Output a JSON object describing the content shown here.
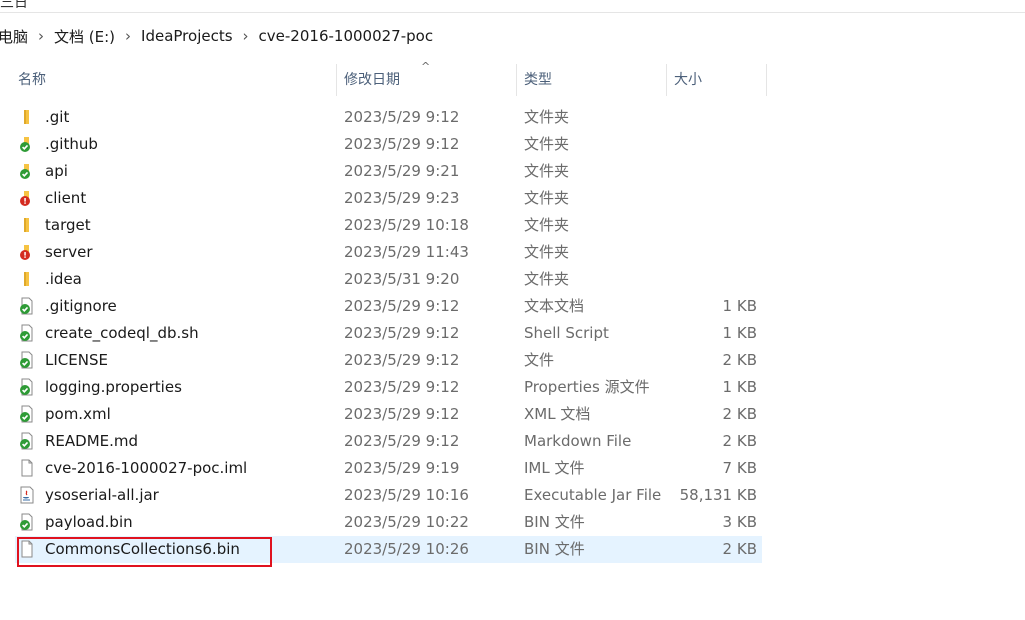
{
  "topstrip": {
    "cut_text": "三日"
  },
  "breadcrumb": {
    "items": [
      "电脑",
      "文档 (E:)",
      "IdeaProjects",
      "cve-2016-1000027-poc"
    ],
    "separator": "›"
  },
  "columns": {
    "name": "名称",
    "date": "修改日期",
    "type": "类型",
    "size": "大小",
    "sort_indicator": "^"
  },
  "files": [
    {
      "name": ".git",
      "date": "2023/5/29 9:12",
      "type": "文件夹",
      "size": "",
      "icon": "folder-icon"
    },
    {
      "name": ".github",
      "date": "2023/5/29 9:12",
      "type": "文件夹",
      "size": "",
      "icon": "folder-synced-icon"
    },
    {
      "name": "api",
      "date": "2023/5/29 9:21",
      "type": "文件夹",
      "size": "",
      "icon": "folder-synced-icon"
    },
    {
      "name": "client",
      "date": "2023/5/29 9:23",
      "type": "文件夹",
      "size": "",
      "icon": "folder-error-icon"
    },
    {
      "name": "target",
      "date": "2023/5/29 10:18",
      "type": "文件夹",
      "size": "",
      "icon": "folder-icon"
    },
    {
      "name": "server",
      "date": "2023/5/29 11:43",
      "type": "文件夹",
      "size": "",
      "icon": "folder-error-icon"
    },
    {
      "name": ".idea",
      "date": "2023/5/31 9:20",
      "type": "文件夹",
      "size": "",
      "icon": "folder-icon"
    },
    {
      "name": ".gitignore",
      "date": "2023/5/29 9:12",
      "type": "文本文档",
      "size": "1 KB",
      "icon": "file-synced-icon"
    },
    {
      "name": "create_codeql_db.sh",
      "date": "2023/5/29 9:12",
      "type": "Shell Script",
      "size": "1 KB",
      "icon": "file-synced-icon"
    },
    {
      "name": "LICENSE",
      "date": "2023/5/29 9:12",
      "type": "文件",
      "size": "2 KB",
      "icon": "file-synced-icon"
    },
    {
      "name": "logging.properties",
      "date": "2023/5/29 9:12",
      "type": "Properties 源文件",
      "size": "1 KB",
      "icon": "file-synced-icon"
    },
    {
      "name": "pom.xml",
      "date": "2023/5/29 9:12",
      "type": "XML 文档",
      "size": "2 KB",
      "icon": "file-synced-icon"
    },
    {
      "name": "README.md",
      "date": "2023/5/29 9:12",
      "type": "Markdown File",
      "size": "2 KB",
      "icon": "file-synced-icon"
    },
    {
      "name": "cve-2016-1000027-poc.iml",
      "date": "2023/5/29 9:19",
      "type": "IML 文件",
      "size": "7 KB",
      "icon": "file-icon"
    },
    {
      "name": "ysoserial-all.jar",
      "date": "2023/5/29 10:16",
      "type": "Executable Jar File",
      "size": "58,131 KB",
      "icon": "java-jar-icon"
    },
    {
      "name": "payload.bin",
      "date": "2023/5/29 10:22",
      "type": "BIN 文件",
      "size": "3 KB",
      "icon": "file-synced-icon"
    },
    {
      "name": "CommonsCollections6.bin",
      "date": "2023/5/29 10:26",
      "type": "BIN 文件",
      "size": "2 KB",
      "icon": "file-icon",
      "selected": true
    }
  ],
  "colors": {
    "selection": "#e5f3ff",
    "highlight_box": "#e0121f",
    "folder": "#f6c343",
    "sync_ok": "#2e9b36",
    "error": "#d42b20"
  }
}
